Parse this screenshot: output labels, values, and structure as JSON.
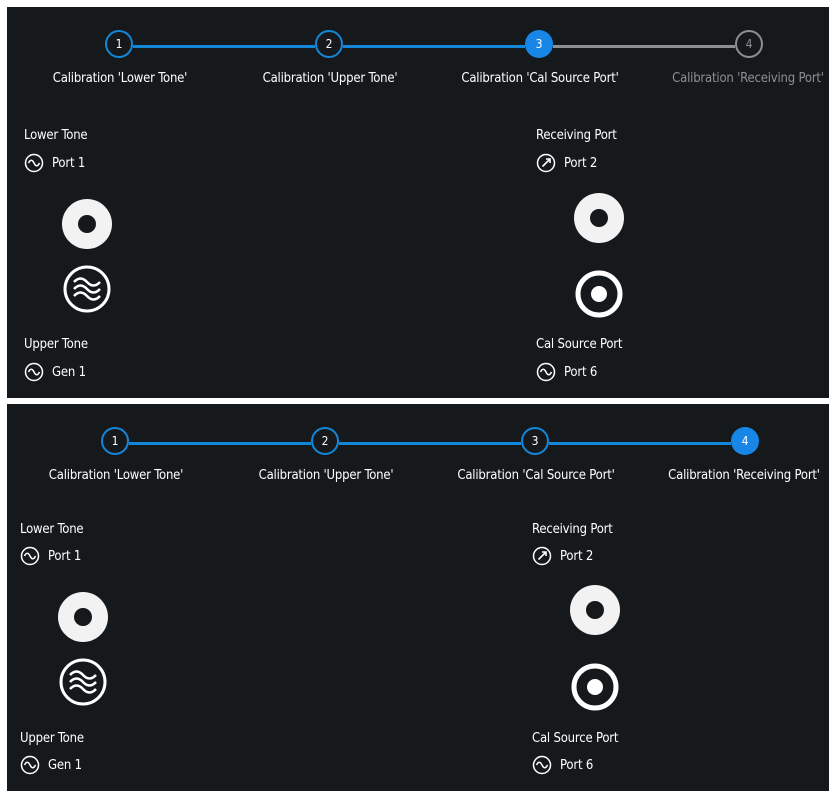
{
  "panels": [
    {
      "steps": [
        {
          "number": "1",
          "label": "Calibration 'Lower Tone'",
          "state": "done"
        },
        {
          "number": "2",
          "label": "Calibration 'Upper Tone'",
          "state": "done"
        },
        {
          "number": "3",
          "label": "Calibration 'Cal Source Port'",
          "state": "active"
        },
        {
          "number": "4",
          "label": "Calibration 'Receiving Port'",
          "state": "pending"
        }
      ],
      "lower_tone": {
        "title": "Lower Tone",
        "port": "Port 1"
      },
      "upper_tone": {
        "title": "Upper Tone",
        "port": "Gen 1"
      },
      "receiving_port": {
        "title": "Receiving Port",
        "port": "Port 2"
      },
      "cal_source_port": {
        "title": "Cal Source Port",
        "port": "Port 6"
      }
    },
    {
      "steps": [
        {
          "number": "1",
          "label": "Calibration 'Lower Tone'",
          "state": "done"
        },
        {
          "number": "2",
          "label": "Calibration 'Upper Tone'",
          "state": "done"
        },
        {
          "number": "3",
          "label": "Calibration 'Cal Source Port'",
          "state": "done"
        },
        {
          "number": "4",
          "label": "Calibration 'Receiving Port'",
          "state": "active"
        }
      ],
      "lower_tone": {
        "title": "Lower Tone",
        "port": "Port 1"
      },
      "upper_tone": {
        "title": "Upper Tone",
        "port": "Gen 1"
      },
      "receiving_port": {
        "title": "Receiving Port",
        "port": "Port 2"
      },
      "cal_source_port": {
        "title": "Cal Source Port",
        "port": "Port 6"
      }
    }
  ],
  "colors": {
    "background": "#16191c",
    "accent": "#1886e6",
    "completed_line": "#1486d8",
    "pending": "#8c8f93",
    "text": "#ffffff"
  }
}
